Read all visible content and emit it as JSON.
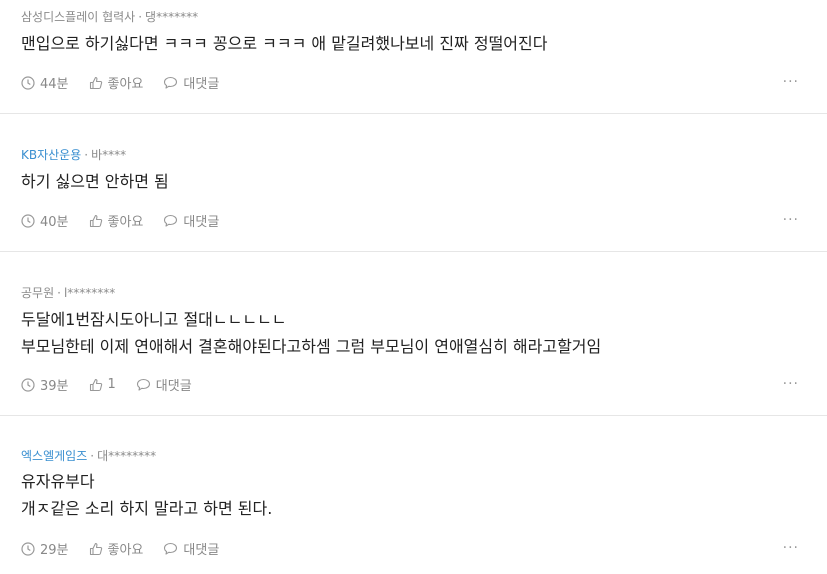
{
  "comments": [
    {
      "company": "삼성디스플레이 협력사",
      "author": "댕*******",
      "lines": [
        "맨입으로 하기싫다면 ㅋㅋㅋ 꽁으로 ㅋㅋㅋ 애 맡길려했나보네 진짜 정떨어진다"
      ],
      "time": "44분",
      "like": "좋아요",
      "reply": "대댓글",
      "more": "···"
    },
    {
      "company": "KB자산운용",
      "author": "바****",
      "lines": [
        "하기 싫으면 안하면 됨"
      ],
      "time": "40분",
      "like": "좋아요",
      "reply": "대댓글",
      "more": "···"
    },
    {
      "company": "공무원",
      "author": "l********",
      "lines": [
        "두달에1번잠시도아니고 절대ㄴㄴㄴㄴㄴ",
        "부모님한테 이제 연애해서 결혼해야된다고하셈 그럼 부모님이 연애열심히 해라고할거임"
      ],
      "time": "39분",
      "like": "1",
      "reply": "대댓글",
      "more": "···"
    },
    {
      "company": "엑스엘게임즈",
      "author": "대********",
      "lines": [
        "유자유부다",
        "개ㅈ같은 소리 하지 말라고 하면 된다."
      ],
      "time": "29분",
      "like": "좋아요",
      "reply": "대댓글",
      "more": "···"
    }
  ],
  "meta_separator": "·",
  "colors": {
    "company_link": "#3a8fd0",
    "muted": "#8a8a8a",
    "text": "#222222"
  }
}
